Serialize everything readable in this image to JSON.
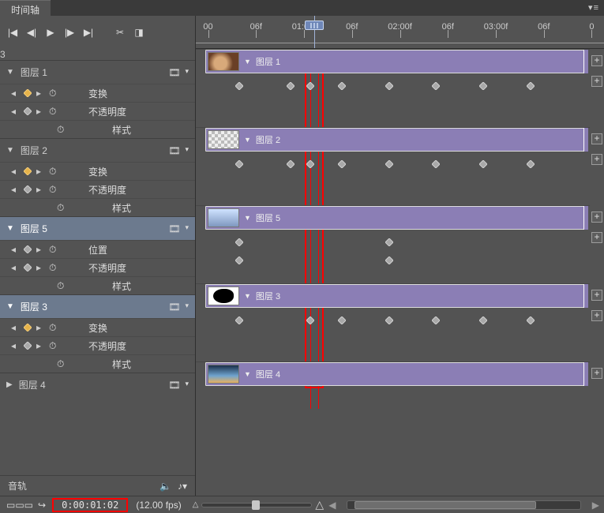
{
  "panel": {
    "tab": "时间轴",
    "flyout_icon": "panel-menu"
  },
  "annotation": {
    "big_number": "3"
  },
  "controls": {
    "first": "⇤",
    "prev": "◁",
    "play": "▷",
    "next": "▷|",
    "last": "⇥",
    "scissors": "✂",
    "transition": "◧"
  },
  "ruler": {
    "labels": [
      "00",
      "06f",
      "01:00f",
      "06f",
      "02:00f",
      "06f",
      "03:00f",
      "06f",
      "0"
    ],
    "playhead_pct": 29
  },
  "layers": [
    {
      "name": "图层 1",
      "clip_name": "图层 1",
      "thumb": "hands",
      "gold_kf": true,
      "selected": false,
      "props": [
        {
          "kind": "kf",
          "gold": true,
          "label": "变换"
        },
        {
          "kind": "kf",
          "gold": false,
          "label": "不透明度"
        },
        {
          "kind": "style",
          "label": "样式"
        }
      ],
      "kf_rows": [
        {
          "pcts": [
            11,
            24,
            29,
            37,
            49,
            61,
            73,
            85
          ]
        },
        {
          "pcts": []
        }
      ]
    },
    {
      "name": "图层 2",
      "clip_name": "图层 2",
      "thumb": "checker",
      "gold_kf": true,
      "selected": false,
      "props": [
        {
          "kind": "kf",
          "gold": true,
          "label": "变换"
        },
        {
          "kind": "kf",
          "gold": false,
          "label": "不透明度"
        },
        {
          "kind": "style",
          "label": "样式"
        }
      ],
      "kf_rows": [
        {
          "pcts": [
            11,
            24,
            29,
            37,
            49,
            61,
            73,
            85
          ]
        },
        {
          "pcts": []
        }
      ]
    },
    {
      "name": "图层 5",
      "clip_name": "图层 5",
      "thumb": "city",
      "gold_kf": false,
      "selected": true,
      "props": [
        {
          "kind": "kf",
          "gold": false,
          "label": "位置"
        },
        {
          "kind": "kf",
          "gold": false,
          "label": "不透明度"
        },
        {
          "kind": "style",
          "label": "样式"
        }
      ],
      "kf_rows": [
        {
          "pcts": [
            11,
            49
          ]
        },
        {
          "pcts": [
            11,
            49
          ]
        }
      ]
    },
    {
      "name": "图层 3",
      "clip_name": "图层 3",
      "thumb": "blob",
      "gold_kf": true,
      "selected": true,
      "props": [
        {
          "kind": "kf",
          "gold": true,
          "label": "变换"
        },
        {
          "kind": "kf",
          "gold": false,
          "label": "不透明度"
        },
        {
          "kind": "style",
          "label": "样式"
        }
      ],
      "kf_rows": [
        {
          "pcts": [
            11,
            29,
            37,
            49,
            61,
            73,
            85
          ]
        },
        {
          "pcts": []
        }
      ]
    },
    {
      "name": "图层 4",
      "clip_name": "图层 4",
      "thumb": "sky",
      "gold_kf": false,
      "selected": false,
      "collapsed": true,
      "props": [],
      "kf_rows": []
    }
  ],
  "audio": {
    "label": "音轨",
    "volume_icon": "音量",
    "music_icon": "♪"
  },
  "bottom": {
    "frame_toggle": "▭▭▭",
    "loop_icon": "↻",
    "timecode": "0:00:01:02",
    "fps": "(12.00 fps)",
    "zoom_knob_pct": 45,
    "scroll_thumb_left_pct": 3,
    "scroll_thumb_width_pct": 78
  }
}
